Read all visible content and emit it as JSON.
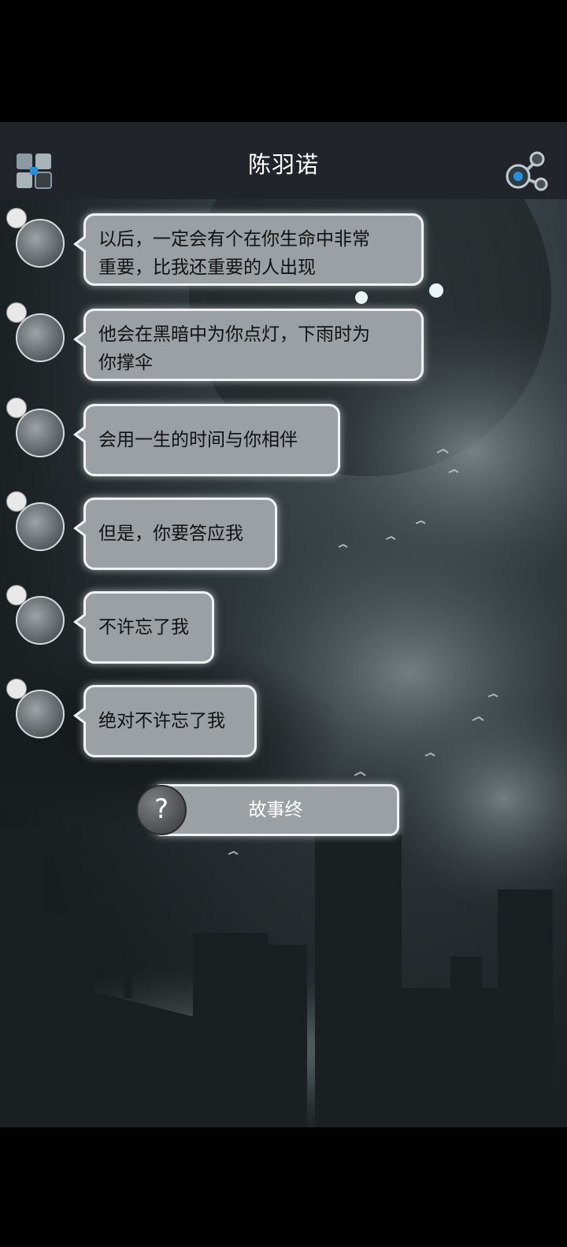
{
  "header": {
    "title": "陈羽诺",
    "menu_icon": "grid-menu-icon",
    "share_icon": "share-icon"
  },
  "colors": {
    "header_bg": "#22242c",
    "bubble_bg": "#9ba0a4",
    "bubble_border": "#f0f2f3"
  },
  "messages": [
    {
      "lines": [
        "以后，一定会有个在你生命中非常",
        "重要，比我还重要的人出现"
      ]
    },
    {
      "lines": [
        "他会在黑暗中为你点灯，下雨时为",
        "你撑伞"
      ]
    },
    {
      "lines": [
        "会用一生的时间与你相伴"
      ]
    },
    {
      "lines": [
        "但是，你要答应我"
      ]
    },
    {
      "lines": [
        "不许忘了我"
      ]
    },
    {
      "lines": [
        "绝对不许忘了我"
      ]
    }
  ],
  "end_button": {
    "label": "故事终",
    "help_symbol": "?"
  }
}
